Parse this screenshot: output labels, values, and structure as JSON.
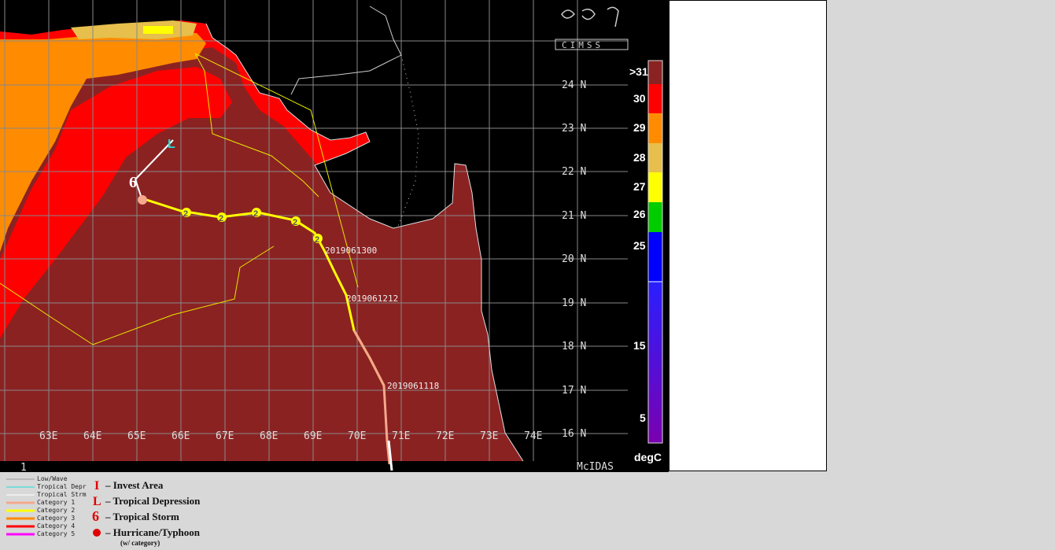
{
  "map": {
    "lat_labels": [
      "24N",
      "23N",
      "22N",
      "21N",
      "20N",
      "19N",
      "18N",
      "17N",
      "16N"
    ],
    "lon_labels": [
      "63E",
      "64E",
      "65E",
      "66E",
      "67E",
      "68E",
      "69E",
      "70E",
      "71E",
      "72E",
      "73E",
      "74E"
    ],
    "corner_label": "1",
    "mcidas_label": "McIDAS",
    "logo_text": "CIMSS",
    "track_labels": [
      "2019061300",
      "2019061212",
      "2019061118"
    ],
    "storm_markers": [
      {
        "type": "tropical-depression",
        "lon": 65.8,
        "lat": 21.7
      },
      {
        "type": "tropical-storm",
        "lon": 64.9,
        "lat": 21.1
      },
      {
        "type": "hurricane",
        "lon": 65.1,
        "lat": 20.8,
        "category": ""
      },
      {
        "type": "hurricane",
        "lon": 66.1,
        "lat": 20.7,
        "category": "2"
      },
      {
        "type": "hurricane",
        "lon": 66.9,
        "lat": 20.6,
        "category": "2"
      },
      {
        "type": "hurricane",
        "lon": 67.7,
        "lat": 20.65,
        "category": "2"
      },
      {
        "type": "hurricane",
        "lon": 68.6,
        "lat": 20.5,
        "category": "2"
      },
      {
        "type": "hurricane",
        "lon": 69.1,
        "lat": 20.25,
        "category": "2"
      }
    ]
  },
  "color_scale": {
    "labels": [
      ">31",
      "30",
      "29",
      "28",
      "27",
      "26",
      "25",
      "15",
      "5"
    ],
    "unit": "degC",
    "colors": [
      "#8b2222",
      "#ff0000",
      "#ff8c00",
      "#e6bf4c",
      "#ffff00",
      "#00cc00",
      "#0000ff",
      "#6a00c8"
    ]
  },
  "legend": {
    "lines": [
      {
        "label": "Low/Wave",
        "color": "#9a9a9a"
      },
      {
        "label": "Tropical Depr",
        "color": "#22dddd"
      },
      {
        "label": "Tropical Strm",
        "color": "#ffffff"
      },
      {
        "label": "Category 1",
        "color": "#f4a88c"
      },
      {
        "label": "Category 2",
        "color": "#ffff00"
      },
      {
        "label": "Category 3",
        "color": "#ff8c00"
      },
      {
        "label": "Category 4",
        "color": "#ff0000"
      },
      {
        "label": "Category 5",
        "color": "#ff00ff"
      }
    ],
    "symbols": [
      {
        "glyph": "I",
        "label": "– Invest Area"
      },
      {
        "glyph": "L",
        "label": "– Tropical Depression"
      },
      {
        "glyph": "6",
        "label": "– Tropical Storm"
      },
      {
        "glyph": "9",
        "label": "– Hurricane/Typhoon"
      }
    ],
    "symbol_note": "(w/ category)"
  }
}
